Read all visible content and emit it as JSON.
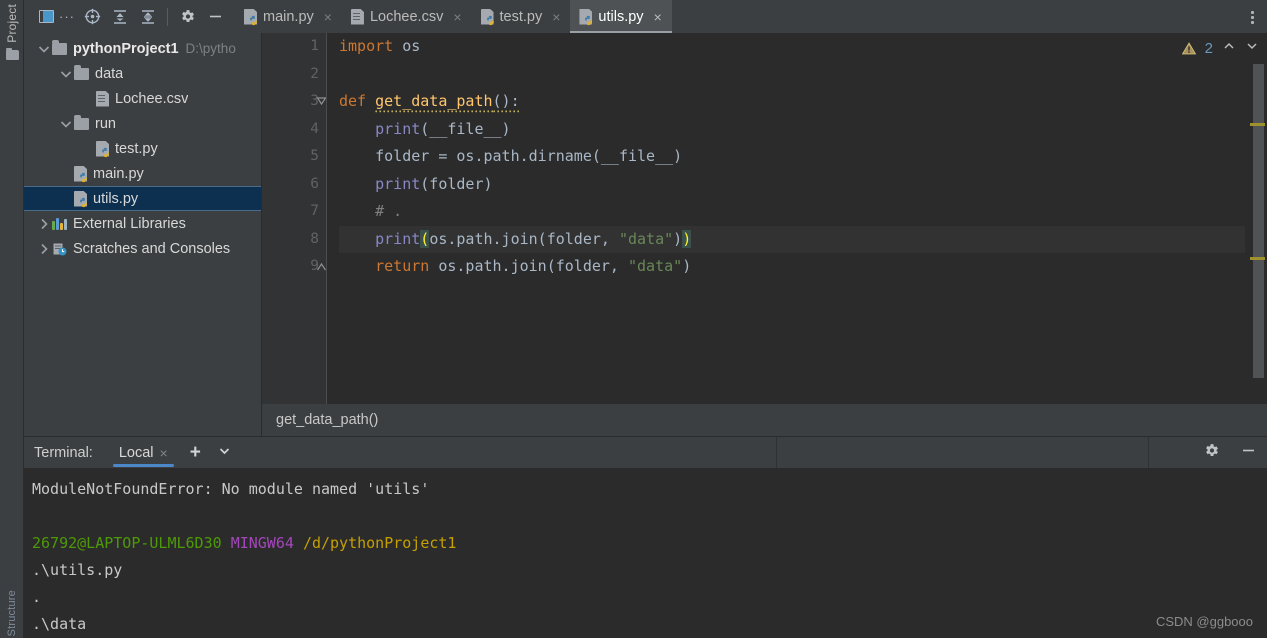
{
  "toolbar": {
    "icons": [
      {
        "name": "project-window-icon",
        "glyph": "project-window"
      },
      {
        "name": "more-options-icon",
        "glyph": "..."
      },
      {
        "name": "locate-file-icon",
        "glyph": "crosshair"
      },
      {
        "name": "expand-all-icon",
        "glyph": "expand-all"
      },
      {
        "name": "collapse-all-icon",
        "glyph": "collapse-all"
      },
      {
        "name": "settings-gear-icon",
        "glyph": "gear"
      },
      {
        "name": "hide-panel-icon",
        "glyph": "minus"
      }
    ],
    "kebab_label": "⋮"
  },
  "left_strip": {
    "project_tab_label": "Project",
    "bottom_tab_label": "Structure"
  },
  "tabs": [
    {
      "label": "main.py",
      "icon": "python-file-icon",
      "active": false,
      "close": "×"
    },
    {
      "label": "Lochee.csv",
      "icon": "csv-file-icon",
      "active": false,
      "close": "×"
    },
    {
      "label": "test.py",
      "icon": "python-file-icon",
      "active": false,
      "close": "×"
    },
    {
      "label": "utils.py",
      "icon": "python-file-icon",
      "active": true,
      "close": "×"
    }
  ],
  "sidebar": {
    "tree": [
      {
        "label": "pythonProject1",
        "note": "D:\\pytho",
        "indent": 0,
        "icon": "folder-icon",
        "expanded": true,
        "bold": true,
        "selected": false,
        "chevron": "down"
      },
      {
        "label": "data",
        "note": "",
        "indent": 1,
        "icon": "folder-icon",
        "expanded": true,
        "bold": false,
        "selected": false,
        "chevron": "down"
      },
      {
        "label": "Lochee.csv",
        "note": "",
        "indent": 2,
        "icon": "csv-file-icon",
        "expanded": null,
        "bold": false,
        "selected": false,
        "chevron": "none"
      },
      {
        "label": "run",
        "note": "",
        "indent": 1,
        "icon": "folder-icon",
        "expanded": true,
        "bold": false,
        "selected": false,
        "chevron": "down"
      },
      {
        "label": "test.py",
        "note": "",
        "indent": 2,
        "icon": "python-file-icon",
        "expanded": null,
        "bold": false,
        "selected": false,
        "chevron": "none"
      },
      {
        "label": "main.py",
        "note": "",
        "indent": 1,
        "icon": "python-file-icon",
        "expanded": null,
        "bold": false,
        "selected": false,
        "chevron": "none"
      },
      {
        "label": "utils.py",
        "note": "",
        "indent": 1,
        "icon": "python-file-icon",
        "expanded": null,
        "bold": false,
        "selected": true,
        "chevron": "none"
      },
      {
        "label": "External Libraries",
        "note": "",
        "indent": 0,
        "icon": "libraries-icon",
        "expanded": false,
        "bold": false,
        "selected": false,
        "chevron": "right"
      },
      {
        "label": "Scratches and Consoles",
        "note": "",
        "indent": 0,
        "icon": "scratches-icon",
        "expanded": false,
        "bold": false,
        "selected": false,
        "chevron": "right"
      }
    ]
  },
  "editor": {
    "line_numbers": [
      "1",
      "2",
      "3",
      "4",
      "5",
      "6",
      "7",
      "8",
      "9"
    ],
    "current_line": 8,
    "warning_count": "2",
    "lines": [
      {
        "n": 1,
        "text": "import os"
      },
      {
        "n": 2,
        "text": ""
      },
      {
        "n": 3,
        "text": "def get_data_path():"
      },
      {
        "n": 4,
        "text": "    print(__file__)"
      },
      {
        "n": 5,
        "text": "    folder = os.path.dirname(__file__)"
      },
      {
        "n": 6,
        "text": "    print(folder)"
      },
      {
        "n": 7,
        "text": "    # ."
      },
      {
        "n": 8,
        "text": "    print(os.path.join(folder, \"data\"))"
      },
      {
        "n": 9,
        "text": "    return os.path.join(folder, \"data\")"
      }
    ],
    "nav_up": "⌃",
    "nav_down": "⌄"
  },
  "breadcrumb": {
    "text": "get_data_path()"
  },
  "terminal": {
    "label": "Terminal:",
    "tab_label": "Local",
    "tab_close": "×",
    "add_label": "+",
    "dropdown_label": "⌄",
    "lines": [
      {
        "segments": [
          {
            "text": "ModuleNotFoundError: No module named 'utils'",
            "color": "default"
          }
        ]
      },
      {
        "segments": [
          {
            "text": "",
            "color": "default"
          }
        ]
      },
      {
        "segments": [
          {
            "text": "26792@LAPTOP-ULML6D30 ",
            "color": "green"
          },
          {
            "text": "MINGW64 ",
            "color": "purple"
          },
          {
            "text": "/d/pythonProject1",
            "color": "yellow"
          }
        ]
      },
      {
        "segments": [
          {
            "text": ".\\utils.py",
            "color": "default"
          }
        ]
      },
      {
        "segments": [
          {
            "text": ".",
            "color": "default"
          }
        ]
      },
      {
        "segments": [
          {
            "text": ".\\data",
            "color": "default"
          }
        ]
      }
    ]
  },
  "watermark": "CSDN @ggbooo",
  "colors": {
    "panel_bg": "#3c3f41",
    "editor_bg": "#2b2b2b",
    "gutter_bg": "#313335",
    "selection_bg": "#0d3050",
    "accent_blue": "#4a88c7",
    "keyword": "#cc7832",
    "string": "#6a8759",
    "function": "#ffc66d",
    "builtin": "#8888c6",
    "comment": "#808080"
  }
}
